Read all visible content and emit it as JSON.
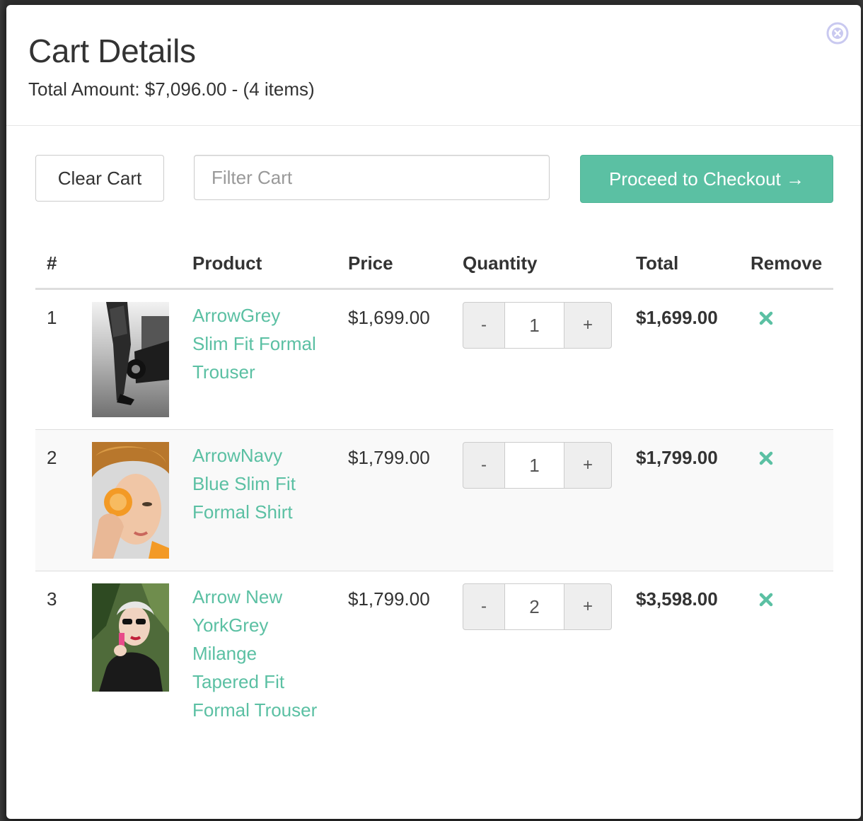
{
  "modal": {
    "title": "Cart Details",
    "summary": "Total Amount: $7,096.00 - (4 items)"
  },
  "toolbar": {
    "clear_label": "Clear Cart",
    "filter_placeholder": "Filter Cart",
    "checkout_label": "Proceed to Checkout →"
  },
  "table": {
    "headers": {
      "num": "#",
      "product": "Product",
      "price": "Price",
      "quantity": "Quantity",
      "total": "Total",
      "remove": "Remove"
    },
    "rows": [
      {
        "num": "1",
        "product": "ArrowGrey Slim Fit Formal Trouser",
        "price": "$1,699.00",
        "quantity": "1",
        "total": "$1,699.00"
      },
      {
        "num": "2",
        "product": "ArrowNavy Blue Slim Fit Formal Shirt",
        "price": "$1,799.00",
        "quantity": "1",
        "total": "$1,799.00"
      },
      {
        "num": "3",
        "product": "Arrow New YorkGrey Milange Tapered Fit Formal Trouser",
        "price": "$1,799.00",
        "quantity": "2",
        "total": "$3,598.00"
      }
    ],
    "qty_minus": "-",
    "qty_plus": "+"
  },
  "colors": {
    "accent": "#5bc0a3",
    "close_icon": "#c9c9f0",
    "text": "#333333"
  },
  "icons": {
    "close": "close-circle-icon",
    "remove": "x-icon"
  }
}
